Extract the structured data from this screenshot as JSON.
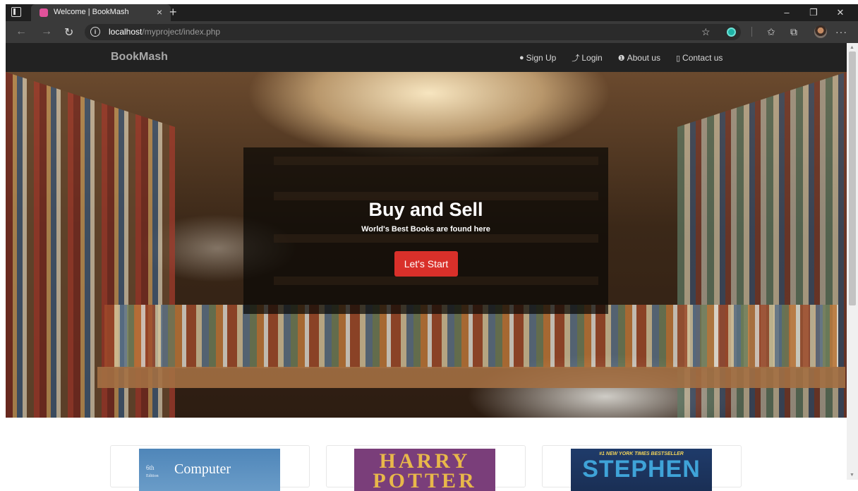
{
  "browser": {
    "tab_title": "Welcome | BookMash",
    "tab_close": "×",
    "new_tab": "+",
    "url_host": "localhost",
    "url_path": "/myproject/index.php",
    "window_controls": {
      "minimize": "–",
      "maximize": "❐",
      "close": "✕"
    },
    "toolbar_icons": [
      "read-aloud-icon",
      "extension-icon",
      "favorites-icon",
      "collections-icon",
      "profile-avatar",
      "more-icon"
    ],
    "more_label": "···"
  },
  "navbar": {
    "brand": "BookMash",
    "links": [
      {
        "icon": "user-icon",
        "glyph": "👤",
        "label": "Sign Up"
      },
      {
        "icon": "login-icon",
        "glyph": "⮐",
        "label": "Login"
      },
      {
        "icon": "info-icon",
        "glyph": "ℹ",
        "label": "About us"
      },
      {
        "icon": "phone-icon",
        "glyph": "▯",
        "label": "Contact us"
      }
    ]
  },
  "hero": {
    "title": "Buy and Sell",
    "subtitle": "World's Best Books are found here",
    "button_label": "Let's Start"
  },
  "books": [
    {
      "edition": "6th",
      "edition_sub": "Edition",
      "title": "Computer"
    },
    {
      "title": "HARRY POTTER"
    },
    {
      "tagline": "#1 NEW YORK TIMES BESTSELLER",
      "title": "STEPHEN"
    }
  ],
  "colors": {
    "navbar_bg": "#222222",
    "button_red": "#d9302a",
    "browser_dark": "#1f1f1f"
  }
}
